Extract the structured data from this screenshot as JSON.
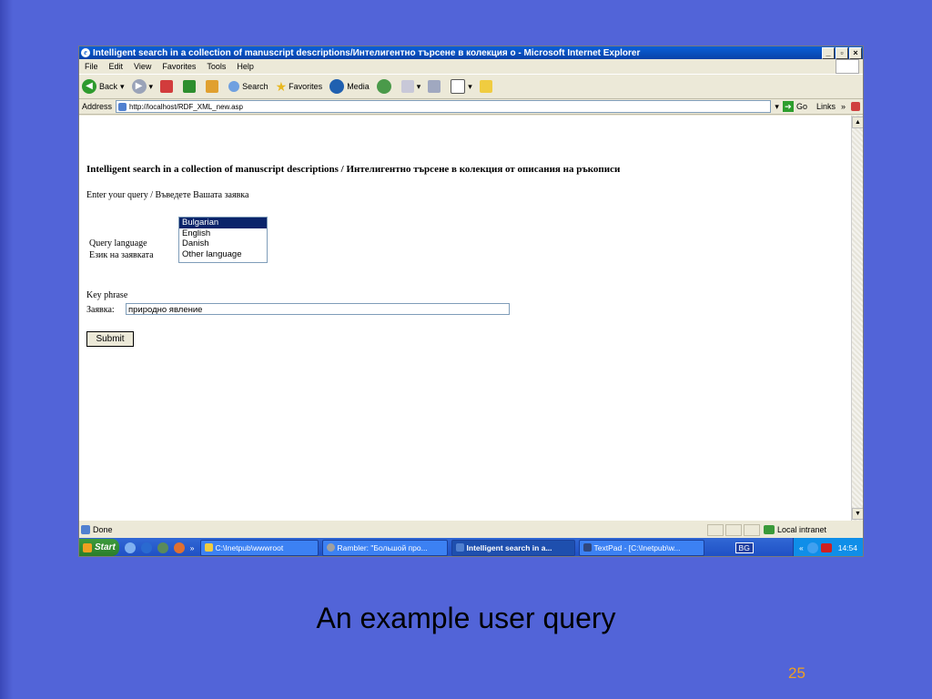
{
  "window": {
    "title": "Intelligent search in a collection of manuscript descriptions/Интелигентно търсене в колекция о - Microsoft Internet Explorer",
    "controls": [
      "_",
      "▫",
      "×"
    ]
  },
  "menu": [
    "File",
    "Edit",
    "View",
    "Favorites",
    "Tools",
    "Help"
  ],
  "toolbar": {
    "back": "Back",
    "search": "Search",
    "favorites": "Favorites",
    "media": "Media"
  },
  "address": {
    "label": "Address",
    "url": "http://localhost/RDF_XML_new.asp",
    "go": "Go",
    "links": "Links"
  },
  "page": {
    "heading": "Intelligent search in a collection of manuscript descriptions / Интелигентно търсене в колекция от описания на ръкописи",
    "prompt": "Enter your query / Въведете Вашата заявка",
    "query_language_label": "Query language",
    "query_language_label_bg": "Език на заявката",
    "languages": [
      "Bulgarian",
      "English",
      "Danish",
      "Other language"
    ],
    "selected_language": "Bulgarian",
    "key_phrase_label": "Key phrase",
    "request_label": "Заявка:",
    "key_phrase_value": "природно явление",
    "submit_label": "Submit"
  },
  "status": {
    "text": "Done",
    "zone": "Local intranet"
  },
  "taskbar": {
    "start": "Start",
    "tasks": [
      "C:\\Inetpub\\wwwroot",
      "Rambler: \"Большой про...",
      "Intelligent search in a...",
      "TextPad - [C:\\Inetpub\\w..."
    ],
    "active_task": 2,
    "lang": "BG",
    "clock": "14:54"
  },
  "slide": {
    "caption": "An example user query",
    "number": "25"
  },
  "colors": {
    "slide_bg": "#5264d8",
    "slide_number": "#f0a020",
    "selection": "#0a246a"
  }
}
